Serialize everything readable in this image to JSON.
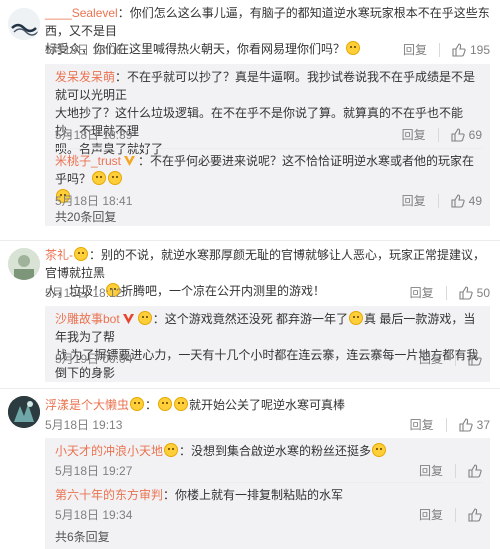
{
  "colors": {
    "username": "#eb7350",
    "text": "#333333",
    "meta": "#808080",
    "reply_bg": "#f2f2f5"
  },
  "actions": {
    "reply": "回复"
  },
  "comments": [
    {
      "user": "____Sealevel",
      "text_lines": [
        "：你们怎么这么事儿逼，有脑子的都知道逆水寒玩家根本不在乎这些东西，又不是目",
        "标受众，你们在这里喊得热火朝天，你看网易理你们吗？"
      ],
      "time": "5月18日 18:06",
      "likes": "195",
      "replies": [
        {
          "user": "发呆发呆萌",
          "text_lines": [
            "：不在乎就可以抄了？真是牛逼啊。我抄试卷说我不在乎成绩是不是就可以光明正",
            "大地抄了？这什么垃圾逻辑。在不在乎不是你说了算。就算真的不在乎也不能抄。不理就不理",
            "呗。名声臭了就好了"
          ],
          "time": "5月18日 18:39",
          "likes": "69"
        },
        {
          "user": "米桃子_trust",
          "text_lines": [
            "：不在乎何必要进来说呢？这不恰恰证明逆水寒或者他的玩家在乎吗？"
          ],
          "time": "5月18日 18:41",
          "likes": "49"
        }
      ],
      "more": "共20条回复"
    },
    {
      "user": "茶礼-",
      "text_lines": [
        "：别的不说，就逆水寒那厚颜无耻的官博就够让人恶心，玩家正常提建议，官博就拉黑",
        "人，垃圾！",
        "折腾吧，一个凉在公开内测里的游戏！"
      ],
      "time": "5月18日 18:12",
      "likes": "50",
      "replies": [
        {
          "user": "沙雕故事bot",
          "text_lines": [
            "：这个游戏竟然还没死 都弃游一年了",
            "真 最后一款游戏，当年我为了帮",
            "战 为了摒镖要进心力，一天有十几个小时都在连云寨，连云寨每一片地方都有我倒下的身影"
          ],
          "time": "5月19日 00:04",
          "likes": ""
        }
      ],
      "more": ""
    },
    {
      "user": "浮漾是个大懒虫",
      "text_lines": [
        "就开始公关了呢逆水寒可真棒"
      ],
      "time": "5月18日 19:13",
      "likes": "37",
      "replies": [
        {
          "user": "小天才的冲浪小天地",
          "text_lines": [
            "：没想到集合啟逆水寒的粉丝还挺多"
          ],
          "time": "5月18日 19:27",
          "likes": ""
        },
        {
          "user": "第六十年的东方审判",
          "text_lines": [
            "：你楼上就有一排复制粘贴的水军"
          ],
          "time": "5月18日 19:34",
          "likes": ""
        }
      ],
      "more": "共6条回复"
    }
  ]
}
